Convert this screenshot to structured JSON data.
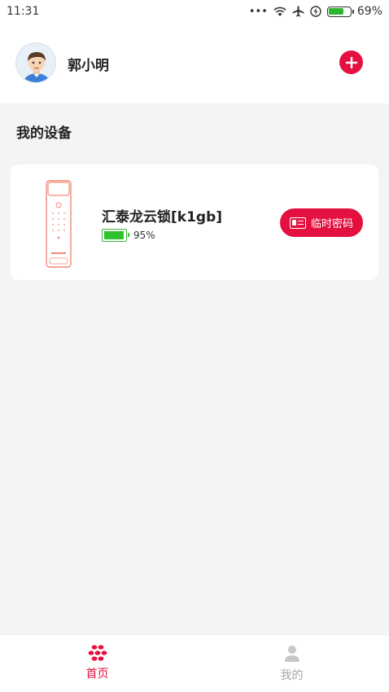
{
  "status_bar": {
    "time": "11:31",
    "signal_dots": "•••",
    "battery_percent": "69%",
    "battery_level": 0.69
  },
  "header": {
    "username": "郭小明"
  },
  "section": {
    "title": "我的设备"
  },
  "device": {
    "name": "汇泰龙云锁[k1gb]",
    "battery_percent": "95%",
    "battery_level": 0.95,
    "temp_password_label": "临时密码"
  },
  "bottom_nav": {
    "items": [
      {
        "label": "首页",
        "icon": "home-icon",
        "active": true
      },
      {
        "label": "我的",
        "icon": "profile-icon",
        "active": false
      }
    ]
  },
  "colors": {
    "accent": "#e4103f",
    "battery_green": "#2ec22e",
    "background": "#f4f4f6"
  }
}
